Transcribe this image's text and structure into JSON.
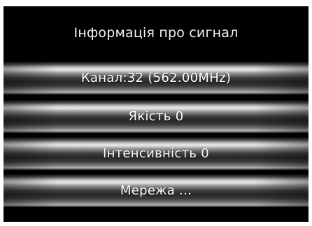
{
  "title": "Інформація про сигнал",
  "rows": [
    {
      "label": "Канал:32 (562.00MHz)"
    },
    {
      "label": "Якість 0"
    },
    {
      "label": "Інтенсивність 0"
    },
    {
      "label": "Мережа ..."
    }
  ],
  "colors": {
    "background": "#000000",
    "text": "#ffffff",
    "bar_highlight": "#eaeaea",
    "bar_shadow": "#272727"
  }
}
